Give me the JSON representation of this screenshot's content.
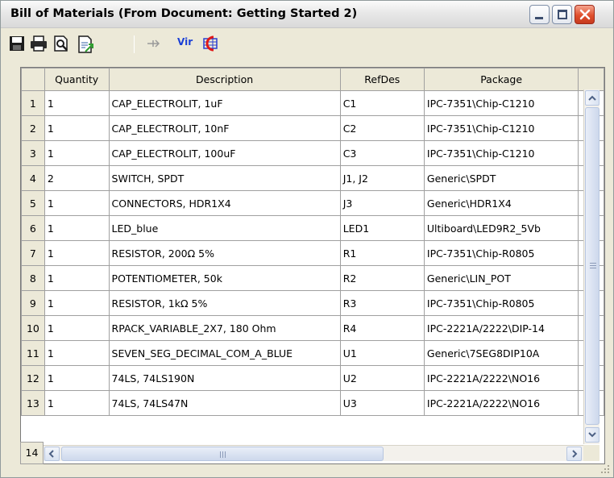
{
  "window": {
    "title": "Bill of Materials (From Document: Getting Started 2)"
  },
  "toolbar": {
    "buttons": [
      {
        "icon": "save-icon"
      },
      {
        "icon": "print-icon"
      },
      {
        "icon": "print-preview-icon"
      },
      {
        "icon": "export-icon"
      },
      {
        "icon": "arrow-icon"
      },
      {
        "icon": "virtual-components-icon",
        "label": "Vir"
      },
      {
        "icon": "component-icon"
      }
    ]
  },
  "grid": {
    "columns": [
      "Quantity",
      "Description",
      "RefDes",
      "Package"
    ],
    "rows": [
      {
        "num": "1",
        "quantity": "1",
        "description": "CAP_ELECTROLIT, 1uF",
        "refdes": "C1",
        "package": "IPC-7351\\Chip-C1210"
      },
      {
        "num": "2",
        "quantity": "1",
        "description": "CAP_ELECTROLIT, 10nF",
        "refdes": "C2",
        "package": "IPC-7351\\Chip-C1210"
      },
      {
        "num": "3",
        "quantity": "1",
        "description": "CAP_ELECTROLIT, 100uF",
        "refdes": "C3",
        "package": "IPC-7351\\Chip-C1210"
      },
      {
        "num": "4",
        "quantity": "2",
        "description": "SWITCH, SPDT",
        "refdes": "J1, J2",
        "package": "Generic\\SPDT"
      },
      {
        "num": "5",
        "quantity": "1",
        "description": "CONNECTORS, HDR1X4",
        "refdes": "J3",
        "package": "Generic\\HDR1X4"
      },
      {
        "num": "6",
        "quantity": "1",
        "description": "LED_blue",
        "refdes": "LED1",
        "package": "Ultiboard\\LED9R2_5Vb"
      },
      {
        "num": "7",
        "quantity": "1",
        "description": "RESISTOR, 200Ω 5%",
        "refdes": "R1",
        "package": "IPC-7351\\Chip-R0805"
      },
      {
        "num": "8",
        "quantity": "1",
        "description": "POTENTIOMETER, 50k",
        "refdes": "R2",
        "package": "Generic\\LIN_POT"
      },
      {
        "num": "9",
        "quantity": "1",
        "description": "RESISTOR, 1kΩ 5%",
        "refdes": "R3",
        "package": "IPC-7351\\Chip-R0805"
      },
      {
        "num": "10",
        "quantity": "1",
        "description": "RPACK_VARIABLE_2X7, 180 Ohm",
        "refdes": "R4",
        "package": "IPC-2221A/2222\\DIP-14"
      },
      {
        "num": "11",
        "quantity": "1",
        "description": "SEVEN_SEG_DECIMAL_COM_A_BLUE",
        "refdes": "U1",
        "package": "Generic\\7SEG8DIP10A"
      },
      {
        "num": "12",
        "quantity": "1",
        "description": "74LS, 74LS190N",
        "refdes": "U2",
        "package": "IPC-2221A/2222\\NO16"
      },
      {
        "num": "13",
        "quantity": "1",
        "description": "74LS, 74LS47N",
        "refdes": "U3",
        "package": "IPC-2221A/2222\\NO16"
      }
    ],
    "partial_row_num": "14"
  }
}
